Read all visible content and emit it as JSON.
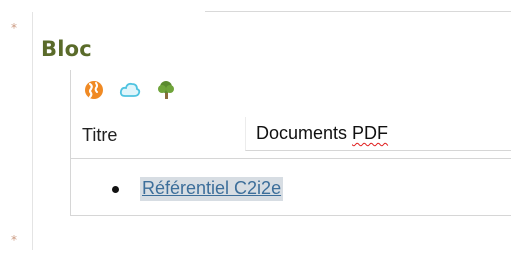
{
  "markers": {
    "top": "*",
    "bottom": "*"
  },
  "bloc": {
    "heading": "Bloc",
    "toolbar": [
      {
        "icon": "globe-icon",
        "color": "#f08a24"
      },
      {
        "icon": "cloud-icon",
        "color": "#4fc3e0"
      },
      {
        "icon": "tree-icon",
        "color": "#5b8a2f"
      }
    ],
    "field": {
      "label": "Titre",
      "value_prefix": "Documents ",
      "value_misspelled": "PDF"
    },
    "list_items": [
      {
        "label": "Référentiel C2i2e"
      }
    ]
  },
  "colors": {
    "heading": "#5a6b2a",
    "link": "#3c6e9a",
    "link_highlight": "#d7dde3",
    "spellcheck": "#e01b1b",
    "marker": "#cc9a82"
  }
}
